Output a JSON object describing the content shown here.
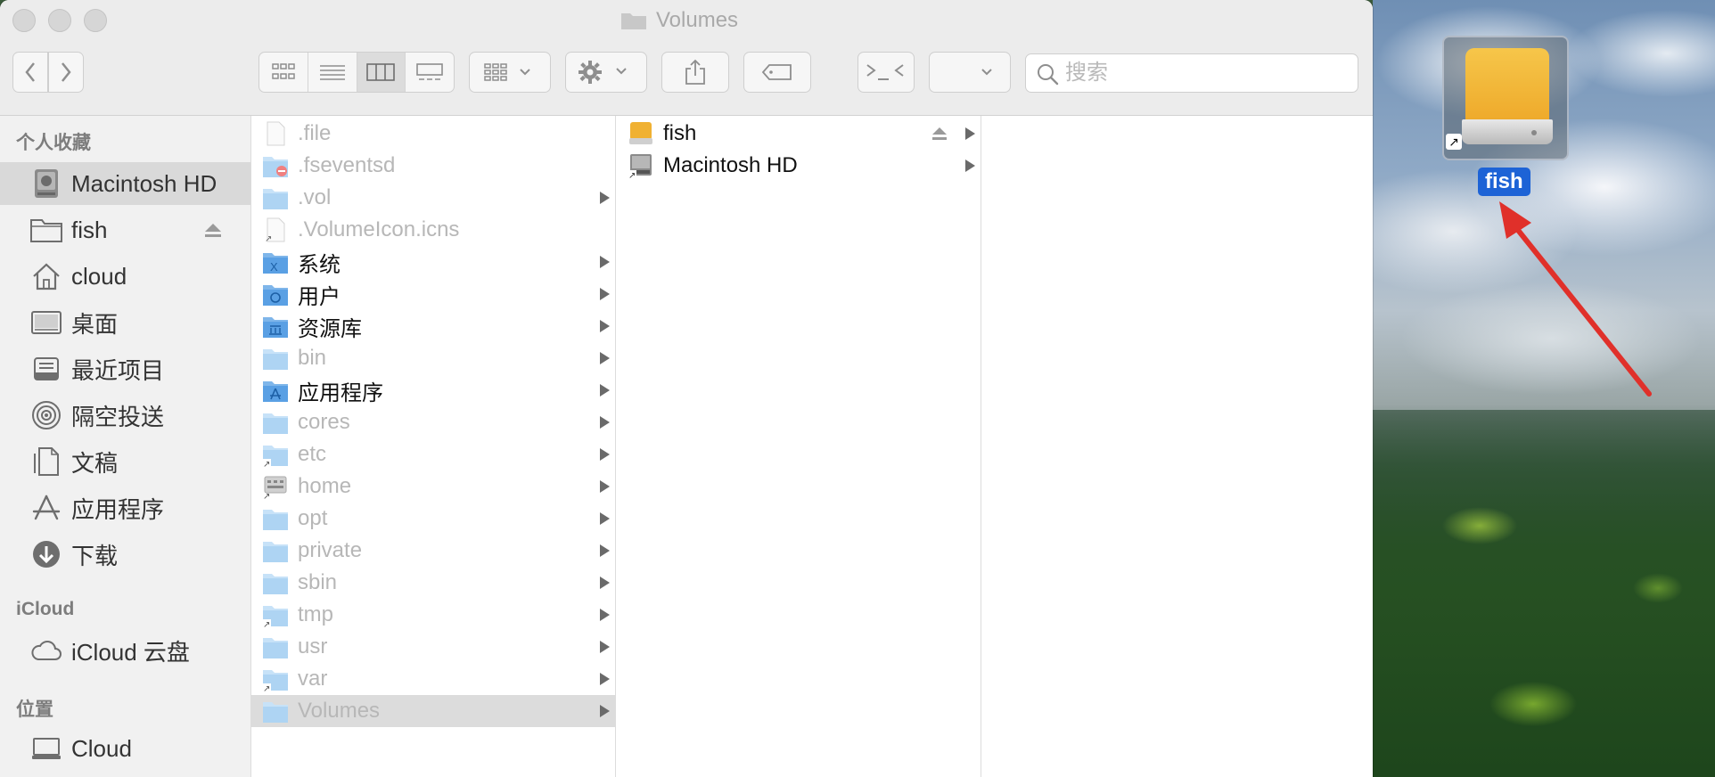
{
  "window": {
    "title": "Volumes"
  },
  "search": {
    "placeholder": "搜索"
  },
  "sidebar": {
    "sections": [
      "个人收藏",
      "iCloud",
      "位置"
    ],
    "favorites": [
      {
        "label": "Macintosh HD",
        "icon": "hard-drive-icon",
        "selected": true
      },
      {
        "label": "fish",
        "icon": "folder-icon",
        "eject": true
      },
      {
        "label": "cloud",
        "icon": "home-icon"
      },
      {
        "label": "桌面",
        "icon": "desktop-icon"
      },
      {
        "label": "最近项目",
        "icon": "recents-icon"
      },
      {
        "label": "隔空投送",
        "icon": "airdrop-icon"
      },
      {
        "label": "文稿",
        "icon": "documents-icon"
      },
      {
        "label": "应用程序",
        "icon": "applications-icon"
      },
      {
        "label": "下载",
        "icon": "downloads-icon"
      }
    ],
    "icloud": [
      {
        "label": "iCloud 云盘",
        "icon": "icloud-icon"
      }
    ],
    "locations": [
      {
        "label": "Cloud",
        "icon": "computer-icon"
      }
    ]
  },
  "column1": [
    {
      "label": ".file",
      "dim": true,
      "icon": "file-icon",
      "chevron": false
    },
    {
      "label": ".fseventsd",
      "dim": true,
      "icon": "restricted-folder-icon",
      "chevron": false
    },
    {
      "label": ".vol",
      "dim": true,
      "icon": "folder-icon",
      "chevron": true
    },
    {
      "label": ".VolumeIcon.icns",
      "dim": true,
      "icon": "alias-file-icon",
      "chevron": false
    },
    {
      "label": "系统",
      "dim": false,
      "icon": "system-folder-icon",
      "chevron": true
    },
    {
      "label": "用户",
      "dim": false,
      "icon": "users-folder-icon",
      "chevron": true
    },
    {
      "label": "资源库",
      "dim": false,
      "icon": "library-folder-icon",
      "chevron": true
    },
    {
      "label": "bin",
      "dim": true,
      "icon": "folder-icon",
      "chevron": true
    },
    {
      "label": "应用程序",
      "dim": false,
      "icon": "applications-folder-icon",
      "chevron": true
    },
    {
      "label": "cores",
      "dim": true,
      "icon": "folder-icon",
      "chevron": true
    },
    {
      "label": "etc",
      "dim": true,
      "icon": "alias-folder-icon",
      "chevron": true
    },
    {
      "label": "home",
      "dim": true,
      "icon": "network-drive-icon",
      "chevron": true
    },
    {
      "label": "opt",
      "dim": true,
      "icon": "folder-icon",
      "chevron": true
    },
    {
      "label": "private",
      "dim": true,
      "icon": "folder-icon",
      "chevron": true
    },
    {
      "label": "sbin",
      "dim": true,
      "icon": "folder-icon",
      "chevron": true
    },
    {
      "label": "tmp",
      "dim": true,
      "icon": "alias-folder-icon",
      "chevron": true
    },
    {
      "label": "usr",
      "dim": true,
      "icon": "folder-icon",
      "chevron": true
    },
    {
      "label": "var",
      "dim": true,
      "icon": "alias-folder-icon",
      "chevron": true
    },
    {
      "label": "Volumes",
      "dim": true,
      "icon": "folder-icon",
      "chevron": true,
      "selected": true
    }
  ],
  "column2": [
    {
      "label": "fish",
      "icon": "external-drive-icon",
      "eject": true,
      "chevron": true
    },
    {
      "label": "Macintosh HD",
      "icon": "hard-drive-alias-icon",
      "eject": false,
      "chevron": true
    }
  ],
  "desktop": {
    "icon_label": "fish",
    "icon": "external-drive-icon"
  },
  "colors": {
    "accent": "#1d63d6",
    "arrow": "#e0302a",
    "drive": "#f0b132"
  }
}
